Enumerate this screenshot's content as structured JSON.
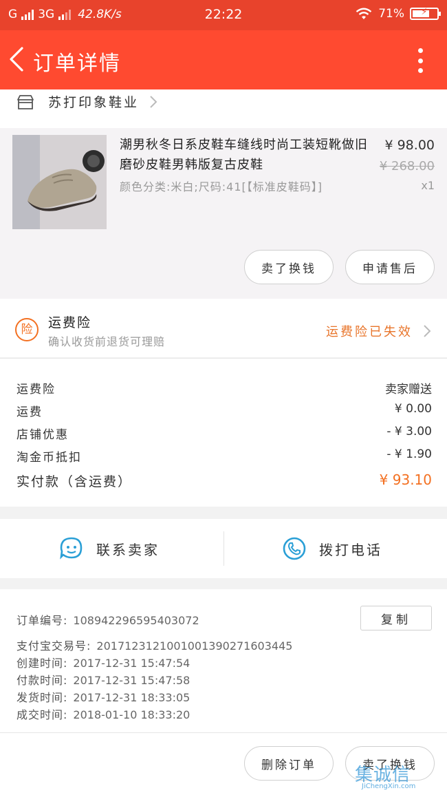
{
  "status_bar": {
    "carrier_signal": "G",
    "network_type": "3G",
    "net_speed": "42.8K/s",
    "time": "22:22",
    "battery_percent": "71%",
    "battery_level": 0.71
  },
  "header": {
    "title": "订单详情",
    "background": "#ff4a30"
  },
  "shop": {
    "name": "苏打印象鞋业"
  },
  "product": {
    "title": "潮男秋冬日系皮鞋车缝线时尚工装短靴做旧磨砂皮鞋男韩版复古皮鞋",
    "sku": "颜色分类:米白;尺码:41[【标准皮鞋码】]",
    "price": "¥ 98.00",
    "original_price": "¥ 268.00",
    "quantity": "x1",
    "buttons": {
      "resell": "卖了换钱",
      "after_sales": "申请售后"
    }
  },
  "insurance": {
    "icon_label": "险",
    "title": "运费险",
    "description": "确认收货前退货可理赔",
    "status": "运费险已失效",
    "status_color": "#e8742a"
  },
  "fees": {
    "rows": [
      {
        "label": "运费险",
        "value": "卖家赠送"
      },
      {
        "label": "运费",
        "value": "¥ 0.00"
      },
      {
        "label": "店铺优惠",
        "value": "- ¥ 3.00"
      },
      {
        "label": "淘金币抵扣",
        "value": "- ¥ 1.90"
      }
    ],
    "total_label": "实付款（含运费）",
    "total_value": "¥ 93.10",
    "accent_color": "#f37021"
  },
  "contact": {
    "seller_label": "联系卖家",
    "phone_label": "拨打电话",
    "icon_color": "#2a9fd6"
  },
  "order_info": {
    "order_no_label": "订单编号:",
    "order_no": "108942296595403072",
    "alipay_label": "支付宝交易号:",
    "alipay_no": "2017123121001001390271603445",
    "created_label": "创建时间:",
    "created": "2017-12-31 15:47:54",
    "paid_label": "付款时间:",
    "paid": "2017-12-31 15:47:58",
    "shipped_label": "发货时间:",
    "shipped": "2017-12-31 18:33:05",
    "completed_label": "成交时间:",
    "completed": "2018-01-10 18:33:20",
    "copy_label": "复制"
  },
  "bottom_actions": {
    "delete": "删除订单",
    "resell": "卖了换钱"
  },
  "watermark": {
    "logo": "集诚信",
    "url": "JiChengXin.com"
  }
}
